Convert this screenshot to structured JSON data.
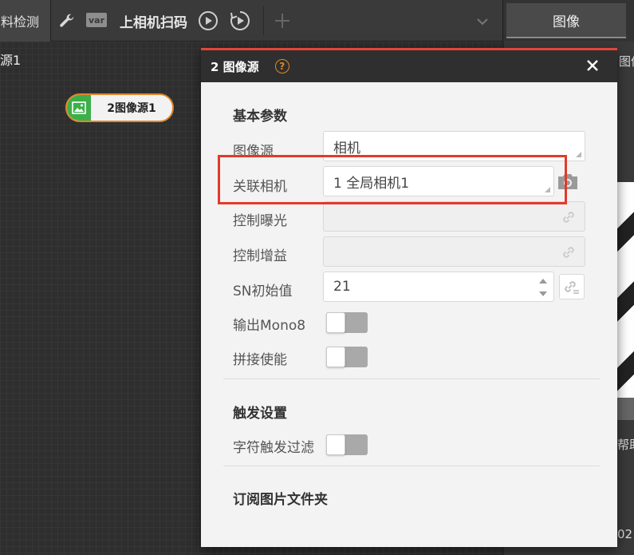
{
  "toolbar": {
    "left_tab_label": "料检测",
    "var_label": "var",
    "flow_title": "上相机扫码",
    "add_symbol": "+"
  },
  "right_tabs": {
    "image_tab": "图像",
    "panel_title": "图像",
    "help_text": "帮助",
    "code_text": "02"
  },
  "canvas": {
    "partial_label": "源1",
    "node_label": "2图像源1"
  },
  "dialog": {
    "title": "2 图像源",
    "help_symbol": "?",
    "sections": {
      "basic": "基本参数",
      "trigger": "触发设置",
      "subscribe": "订阅图片文件夹"
    },
    "fields": {
      "image_source_label": "图像源",
      "image_source_value": "相机",
      "linked_camera_label": "关联相机",
      "linked_camera_value": "1 全局相机1",
      "control_exposure_label": "控制曝光",
      "control_gain_label": "控制增益",
      "sn_initial_label": "SN初始值",
      "sn_initial_value": "21",
      "output_mono8_label": "输出Mono8",
      "stitch_enable_label": "拼接使能",
      "char_trigger_filter_label": "字符触发过滤"
    },
    "toggles": {
      "output_mono8": false,
      "stitch_enable": false,
      "char_trigger_filter": false
    }
  },
  "colors": {
    "accent_orange": "#e0862a",
    "node_green": "#3daf4a",
    "dialog_accent_red": "#e2463a",
    "annotation_red": "#e23a2a"
  }
}
